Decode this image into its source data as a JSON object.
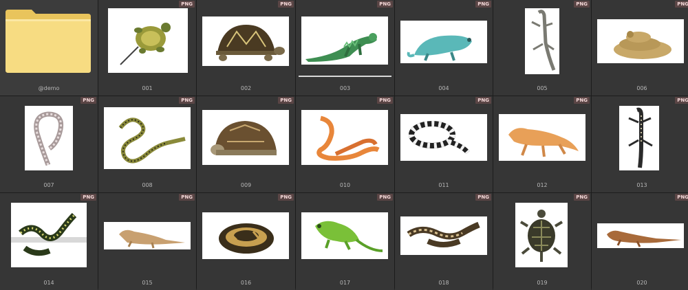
{
  "folder": {
    "label": "@demo",
    "icon": "folder-icon"
  },
  "items": [
    {
      "label": "001",
      "badge": "PNG",
      "icon": "turtle-icon"
    },
    {
      "label": "002",
      "badge": "PNG",
      "icon": "tortoise-icon"
    },
    {
      "label": "003",
      "badge": "PNG",
      "icon": "iguana-icon"
    },
    {
      "label": "004",
      "badge": "PNG",
      "icon": "chameleon-icon"
    },
    {
      "label": "005",
      "badge": "PNG",
      "icon": "gecko-icon"
    },
    {
      "label": "006",
      "badge": "PNG",
      "icon": "coiled-snake-icon"
    },
    {
      "label": "007",
      "badge": "PNG",
      "icon": "snake-icon"
    },
    {
      "label": "008",
      "badge": "PNG",
      "icon": "snake-icon"
    },
    {
      "label": "009",
      "badge": "PNG",
      "icon": "tortoise-icon"
    },
    {
      "label": "010",
      "badge": "PNG",
      "icon": "corn-snake-icon"
    },
    {
      "label": "011",
      "badge": "PNG",
      "icon": "kingsnake-icon"
    },
    {
      "label": "012",
      "badge": "PNG",
      "icon": "bearded-dragon-icon"
    },
    {
      "label": "013",
      "badge": "PNG",
      "icon": "gecko-icon"
    },
    {
      "label": "014",
      "badge": "PNG",
      "icon": "snake-icon"
    },
    {
      "label": "015",
      "badge": "PNG",
      "icon": "bearded-dragon-icon"
    },
    {
      "label": "016",
      "badge": "PNG",
      "icon": "python-icon"
    },
    {
      "label": "017",
      "badge": "PNG",
      "icon": "chameleon-icon"
    },
    {
      "label": "018",
      "badge": "PNG",
      "icon": "python-icon"
    },
    {
      "label": "019",
      "badge": "PNG",
      "icon": "turtle-icon"
    },
    {
      "label": "020",
      "badge": "PNG",
      "icon": "iguana-icon"
    }
  ],
  "colors": {
    "background": "#262626",
    "cell": "#363636",
    "badge_bg": "#5a4545",
    "badge_text": "#f4d8d8",
    "caption_text": "#b8b8b8",
    "folder_body": "#f5d77a",
    "selection_underline": "#d8d8d8"
  }
}
